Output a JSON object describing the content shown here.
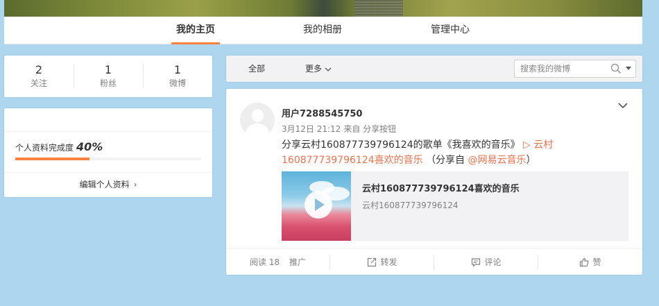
{
  "nav": {
    "tabs": [
      {
        "label": "我的主页",
        "active": true
      },
      {
        "label": "我的相册",
        "active": false
      },
      {
        "label": "管理中心",
        "active": false
      }
    ]
  },
  "stats": [
    {
      "value": "2",
      "label": "关注"
    },
    {
      "value": "1",
      "label": "粉丝"
    },
    {
      "value": "1",
      "label": "微博"
    }
  ],
  "profile": {
    "completeness_label": "个人资料完成度",
    "completeness_value": "40%",
    "completeness_fraction": 0.4,
    "edit_label": "编辑个人资料",
    "accent_color": "#ff8140"
  },
  "feed_toolbar": {
    "all_label": "全部",
    "more_label": "更多",
    "search_placeholder": "搜索我的微博"
  },
  "post": {
    "username": "用户7288545750",
    "date": "3月12日 21:12",
    "source": "来自 分享按钮",
    "text_prefix": "分享云村160877739796124的歌单《我喜欢的音乐》 ",
    "link_text": "▷ 云村160877739796124喜欢的音乐",
    "share_from_prefix": "（分享自 ",
    "share_from_link": "@网易云音乐",
    "share_from_suffix": "）",
    "link_color": "#eb7350",
    "card": {
      "title": "云村160877739796124喜欢的音乐",
      "subtitle": "云村160877739796124"
    },
    "actions": {
      "read_label": "阅读 18",
      "promote_label": "推广",
      "repost_label": "转发",
      "comment_label": "评论",
      "like_label": "赞"
    }
  }
}
